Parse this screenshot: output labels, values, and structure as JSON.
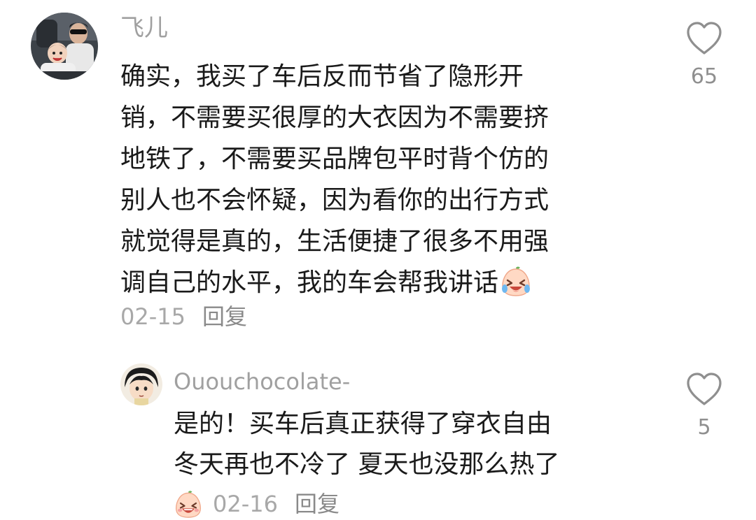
{
  "comment": {
    "username": "飞儿",
    "text_lines": [
      "确实，我买了车后反而节省了隐形开",
      "销，不需要买很厚的大衣因为不需要挤",
      "地铁了，不需要买品牌包平时背个仿的",
      "别人也不会怀疑，因为看你的出行方式",
      "就觉得是真的，生活便捷了很多不用强",
      "调自己的水平，我的车会帮我讲话"
    ],
    "trailing_emoji": "laugh-cry-emoji",
    "date": "02-15",
    "reply_label": "回复",
    "like_count": "65",
    "like_icon": "heart-outline-icon"
  },
  "reply": {
    "username": "Ououchocolate-",
    "text_lines": [
      "是的！买车后真正获得了穿衣自由",
      "冬天再也不冷了 夏天也没那么热了"
    ],
    "leading_emoji": "laugh-emoji",
    "date": "02-16",
    "reply_label": "回复",
    "like_count": "5",
    "like_icon": "heart-outline-icon"
  },
  "colors": {
    "username": "#a0a0a0",
    "text": "#1a1a1a",
    "meta": "#a8a8a8",
    "icon": "#8f8f8f"
  }
}
